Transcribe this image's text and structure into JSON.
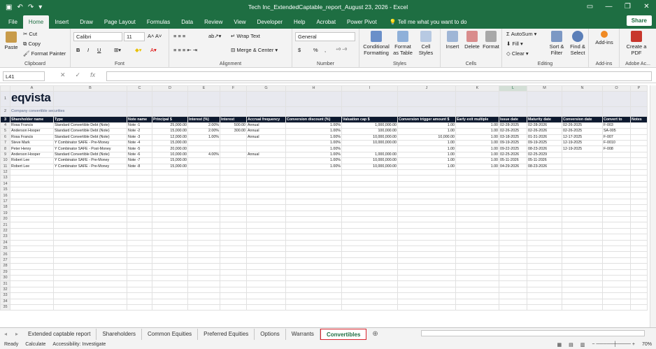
{
  "window": {
    "title": "Tech Inc_ExtendedCaptable_report_August 23, 2026  -  Excel",
    "autosave_glyph": "▣",
    "undo_glyph": "↶",
    "redo_glyph": "↷",
    "more_glyph": "▾"
  },
  "ribbon_tabs": [
    "File",
    "Home",
    "Insert",
    "Draw",
    "Page Layout",
    "Formulas",
    "Data",
    "Review",
    "View",
    "Developer",
    "Help",
    "Acrobat",
    "Power Pivot"
  ],
  "tell_me": "Tell me what you want to do",
  "share": "Share",
  "clipboard": {
    "paste": "Paste",
    "cut": "Cut",
    "copy": "Copy",
    "format_painter": "Format Painter",
    "label": "Clipboard"
  },
  "font": {
    "name": "Calibri",
    "size": "11",
    "label": "Font",
    "bold": "B",
    "italic": "I",
    "underline": "U"
  },
  "alignment": {
    "wrap": "Wrap Text",
    "merge": "Merge & Center",
    "label": "Alignment"
  },
  "number": {
    "format": "General",
    "label": "Number",
    "currency": "$",
    "percent": "%",
    "comma": ","
  },
  "styles": {
    "conditional": "Conditional Formatting",
    "format_table": "Format as Table",
    "cell_styles": "Cell Styles",
    "label": "Styles"
  },
  "cells": {
    "insert": "Insert",
    "delete": "Delete",
    "format": "Format",
    "label": "Cells"
  },
  "editing": {
    "autosum": "AutoSum",
    "fill": "Fill",
    "clear": "Clear",
    "sort": "Sort & Filter",
    "find": "Find & Select",
    "label": "Editing"
  },
  "addins": {
    "addins": "Add-ins",
    "label": "Add-ins"
  },
  "adobe": {
    "create": "Create a PDF",
    "label": "Adobe Ac..."
  },
  "namebox": "L41",
  "fx": "fx",
  "columns": [
    "A",
    "B",
    "C",
    "D",
    "E",
    "F",
    "G",
    "H",
    "I",
    "J",
    "K",
    "L",
    "M",
    "N",
    "O",
    "P"
  ],
  "logo": "eqvista",
  "subtitle": "Company convertible securities",
  "headers": [
    "Shareholder name",
    "Type",
    "Note name",
    "Principal $",
    "Interest (%)",
    "Interest",
    "Accrual frequency",
    "Conversion discount (%)",
    "Valuation cap $",
    "Conversion trigger amount $",
    "Early exit multiple",
    "Issue date",
    "Maturity date",
    "Conversion date",
    "Convert to",
    "Notes"
  ],
  "rows": [
    [
      "Rosa Francis",
      "Standard Convertible Debt (Note)",
      "Note -1",
      "25,000.00",
      "2.00%",
      "500.00",
      "Annual",
      "1.00%",
      "1,000,000.00",
      "1.00",
      "1.00",
      "02-28-2025",
      "02-28-2026",
      "02-26-2025",
      "F-003",
      ""
    ],
    [
      "Anderson Hooper",
      "Standard Convertible Debt (Note)",
      "Note -2",
      "15,000.00",
      "2.00%",
      "300.00",
      "Annual",
      "1.00%",
      "100,000.00",
      "1.00",
      "1.00",
      "02-26-2025",
      "02-26-2026",
      "02-26-2025",
      "SA-005",
      ""
    ],
    [
      "Rosa Francis",
      "Standard Convertible Debt (Note)",
      "Note -3",
      "12,000.00",
      "1.00%",
      "",
      "Annual",
      "1.00%",
      "10,000,000.00",
      "10,000.00",
      "1.00",
      "03-18-2025",
      "01-31-2026",
      "12-17-2025",
      "F-007",
      ""
    ],
    [
      "Steve Mark",
      "Y Combinator SAFE - Pre-Money",
      "Note -4",
      "15,000.00",
      "",
      "",
      "",
      "1.00%",
      "10,000,000.00",
      "1.00",
      "1.00",
      "09-19-2025",
      "09-19-2025",
      "12-19-2025",
      "F-0010",
      ""
    ],
    [
      "Peter Henry",
      "Y Combinator SAFE - Post-Money",
      "Note -5",
      "20,000.00",
      "",
      "",
      "",
      "1.00%",
      "",
      "1.00",
      "1.00",
      "09-22-2025",
      "08-23-2026",
      "12-19-2025",
      "F-008",
      ""
    ],
    [
      "Anderson Hooper",
      "Standard Convertible Debt (Note)",
      "Note -6",
      "10,000.00",
      "4.00%",
      "",
      "Annual",
      "1.00%",
      "1,000,000.00",
      "1.00",
      "1.00",
      "02-25-2026",
      "02-25-2029",
      "",
      "",
      ""
    ],
    [
      "Robert Lee",
      "Y Combinator SAFE - Pre-Money",
      "Note -7",
      "15,000.00",
      "",
      "",
      "",
      "1.00%",
      "10,000,000.00",
      "1.00",
      "1.00",
      "05-11-2026",
      "05-11-2026",
      "",
      "",
      ""
    ],
    [
      "Robert Lee",
      "Y Combinator SAFE - Pre-Money",
      "Note -8",
      "15,000.00",
      "",
      "",
      "",
      "1.00%",
      "10,000,000.00",
      "1.00",
      "1.00",
      "04-29-2026",
      "08-23-2026",
      "",
      "",
      ""
    ]
  ],
  "row_numbers": [
    "1",
    "2",
    "3",
    "4",
    "5",
    "6",
    "7",
    "8",
    "9",
    "10",
    "11",
    "12",
    "13",
    "14",
    "15",
    "16",
    "17",
    "18",
    "19",
    "20",
    "21",
    "22",
    "23",
    "24",
    "25",
    "26",
    "27",
    "28",
    "29",
    "30",
    "31",
    "32",
    "33",
    "34",
    "35"
  ],
  "sheet_tabs": [
    "Extended captable report",
    "Shareholders",
    "Common Equities",
    "Preferred Equities",
    "Options",
    "Warrants",
    "Convertibles"
  ],
  "active_sheet": "Convertibles",
  "status": {
    "ready": "Ready",
    "calculate": "Calculate",
    "accessibility": "Accessibility: Investigate",
    "zoom": "70%"
  },
  "colors": {
    "excel_green": "#1e6e42",
    "header_navy": "#0e1a30",
    "active_tab_border": "#d9232c"
  }
}
